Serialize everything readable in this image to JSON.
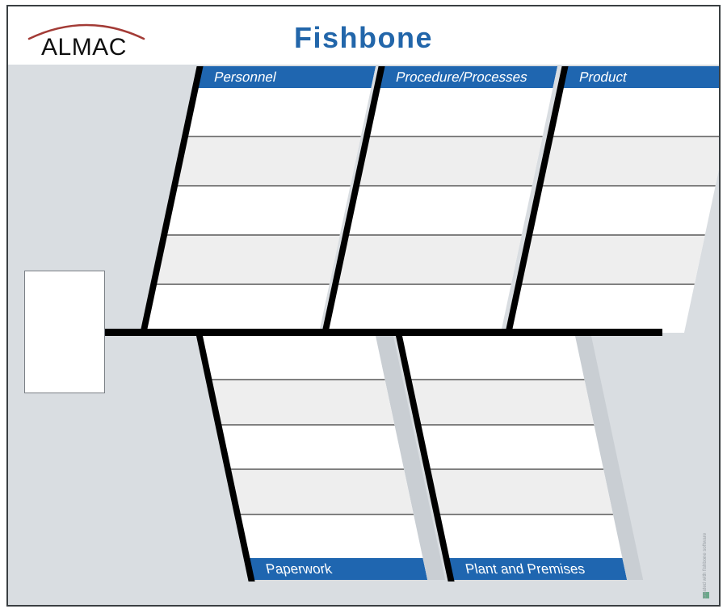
{
  "header": {
    "logo_text": "ALMAC",
    "logo_arc_color": "#a33b36",
    "title": "Fishbone"
  },
  "colors": {
    "header_blue": "#1f66b0",
    "title_blue": "#2266aa",
    "canvas_bg": "#d9dde1",
    "bone_white": "#ffffff",
    "bone_alt": "#eeeeee",
    "row_line": "#808080",
    "spine_black": "#000000",
    "shadow": "#c9ced3",
    "frame_border": "#3a3f42"
  },
  "diagram": {
    "effect_box": {
      "label": ""
    },
    "spine": {
      "label": ""
    },
    "bones_top": [
      {
        "label": "Personnel",
        "rows": [
          "",
          "",
          "",
          "",
          ""
        ]
      },
      {
        "label": "Procedure/Processes",
        "rows": [
          "",
          "",
          "",
          "",
          ""
        ]
      },
      {
        "label": "Product",
        "rows": [
          "",
          "",
          "",
          "",
          ""
        ]
      }
    ],
    "bones_bottom": [
      {
        "label": "Paperwork",
        "rows": [
          "",
          "",
          "",
          "",
          ""
        ]
      },
      {
        "label": "Plant and Premises",
        "rows": [
          "",
          "",
          "",
          "",
          ""
        ]
      }
    ]
  },
  "watermark": {
    "text": "created with fishbone software"
  }
}
